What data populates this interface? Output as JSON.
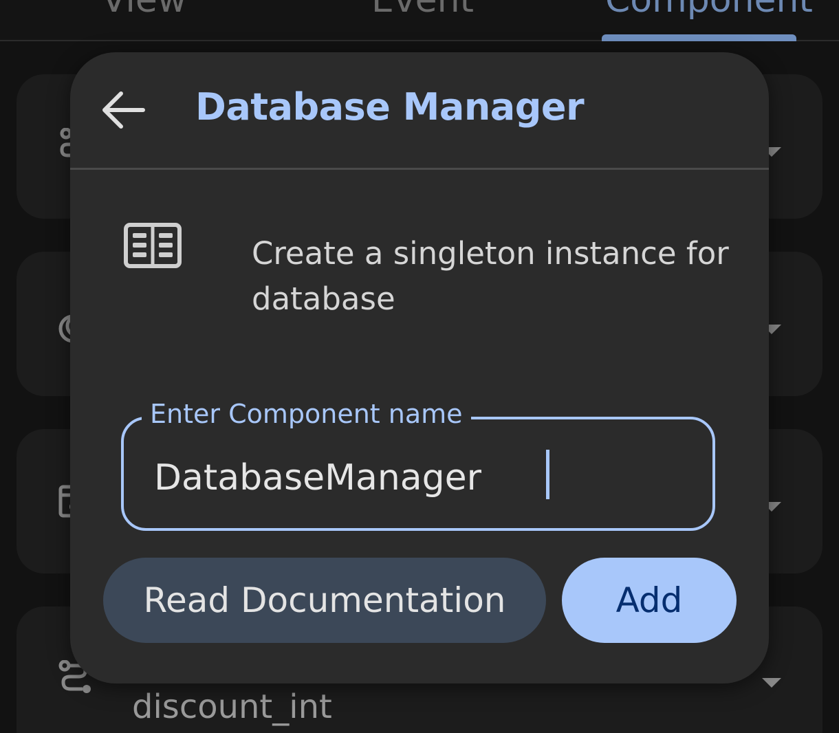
{
  "tabs": [
    {
      "label": "View",
      "selected": false
    },
    {
      "label": "Event",
      "selected": false
    },
    {
      "label": "Component",
      "selected": true
    }
  ],
  "background_list": {
    "visible_item_text": "discount_int"
  },
  "dialog": {
    "title": "Database Manager",
    "back_icon": "arrow-left-icon",
    "component_icon": "document-list-icon",
    "description": "Create a singleton instance for database",
    "name_field": {
      "label": "Enter Component name",
      "value": "DatabaseManager"
    },
    "buttons": {
      "docs_label": "Read Documentation",
      "add_label": "Add"
    }
  },
  "colors": {
    "accent": "#a8c7fa",
    "dialog_bg": "#2b2b2b",
    "secondary_button": "#3c4858",
    "primary_button_text": "#062e6f"
  }
}
